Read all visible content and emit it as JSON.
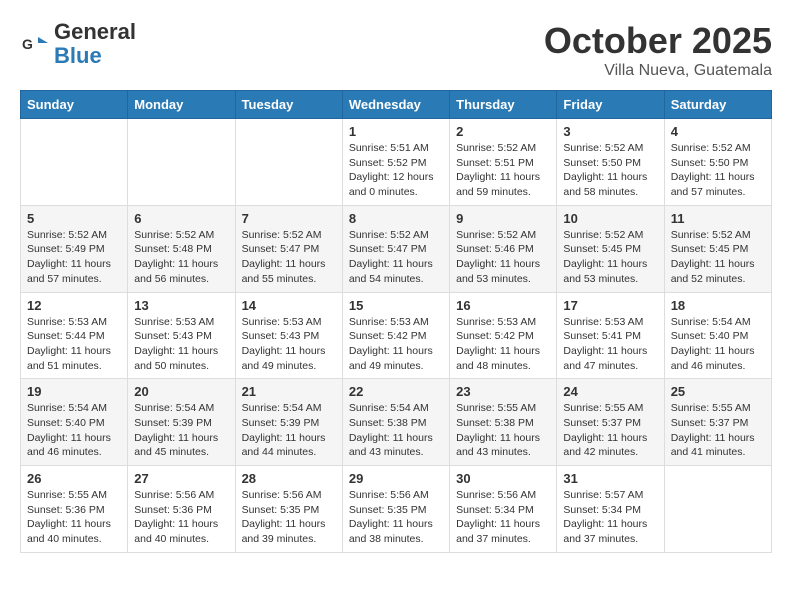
{
  "header": {
    "logo_line1": "General",
    "logo_line2": "Blue",
    "month_title": "October 2025",
    "location": "Villa Nueva, Guatemala"
  },
  "weekdays": [
    "Sunday",
    "Monday",
    "Tuesday",
    "Wednesday",
    "Thursday",
    "Friday",
    "Saturday"
  ],
  "weeks": [
    [
      {
        "day": "",
        "info": ""
      },
      {
        "day": "",
        "info": ""
      },
      {
        "day": "",
        "info": ""
      },
      {
        "day": "1",
        "info": "Sunrise: 5:51 AM\nSunset: 5:52 PM\nDaylight: 12 hours\nand 0 minutes."
      },
      {
        "day": "2",
        "info": "Sunrise: 5:52 AM\nSunset: 5:51 PM\nDaylight: 11 hours\nand 59 minutes."
      },
      {
        "day": "3",
        "info": "Sunrise: 5:52 AM\nSunset: 5:50 PM\nDaylight: 11 hours\nand 58 minutes."
      },
      {
        "day": "4",
        "info": "Sunrise: 5:52 AM\nSunset: 5:50 PM\nDaylight: 11 hours\nand 57 minutes."
      }
    ],
    [
      {
        "day": "5",
        "info": "Sunrise: 5:52 AM\nSunset: 5:49 PM\nDaylight: 11 hours\nand 57 minutes."
      },
      {
        "day": "6",
        "info": "Sunrise: 5:52 AM\nSunset: 5:48 PM\nDaylight: 11 hours\nand 56 minutes."
      },
      {
        "day": "7",
        "info": "Sunrise: 5:52 AM\nSunset: 5:47 PM\nDaylight: 11 hours\nand 55 minutes."
      },
      {
        "day": "8",
        "info": "Sunrise: 5:52 AM\nSunset: 5:47 PM\nDaylight: 11 hours\nand 54 minutes."
      },
      {
        "day": "9",
        "info": "Sunrise: 5:52 AM\nSunset: 5:46 PM\nDaylight: 11 hours\nand 53 minutes."
      },
      {
        "day": "10",
        "info": "Sunrise: 5:52 AM\nSunset: 5:45 PM\nDaylight: 11 hours\nand 53 minutes."
      },
      {
        "day": "11",
        "info": "Sunrise: 5:52 AM\nSunset: 5:45 PM\nDaylight: 11 hours\nand 52 minutes."
      }
    ],
    [
      {
        "day": "12",
        "info": "Sunrise: 5:53 AM\nSunset: 5:44 PM\nDaylight: 11 hours\nand 51 minutes."
      },
      {
        "day": "13",
        "info": "Sunrise: 5:53 AM\nSunset: 5:43 PM\nDaylight: 11 hours\nand 50 minutes."
      },
      {
        "day": "14",
        "info": "Sunrise: 5:53 AM\nSunset: 5:43 PM\nDaylight: 11 hours\nand 49 minutes."
      },
      {
        "day": "15",
        "info": "Sunrise: 5:53 AM\nSunset: 5:42 PM\nDaylight: 11 hours\nand 49 minutes."
      },
      {
        "day": "16",
        "info": "Sunrise: 5:53 AM\nSunset: 5:42 PM\nDaylight: 11 hours\nand 48 minutes."
      },
      {
        "day": "17",
        "info": "Sunrise: 5:53 AM\nSunset: 5:41 PM\nDaylight: 11 hours\nand 47 minutes."
      },
      {
        "day": "18",
        "info": "Sunrise: 5:54 AM\nSunset: 5:40 PM\nDaylight: 11 hours\nand 46 minutes."
      }
    ],
    [
      {
        "day": "19",
        "info": "Sunrise: 5:54 AM\nSunset: 5:40 PM\nDaylight: 11 hours\nand 46 minutes."
      },
      {
        "day": "20",
        "info": "Sunrise: 5:54 AM\nSunset: 5:39 PM\nDaylight: 11 hours\nand 45 minutes."
      },
      {
        "day": "21",
        "info": "Sunrise: 5:54 AM\nSunset: 5:39 PM\nDaylight: 11 hours\nand 44 minutes."
      },
      {
        "day": "22",
        "info": "Sunrise: 5:54 AM\nSunset: 5:38 PM\nDaylight: 11 hours\nand 43 minutes."
      },
      {
        "day": "23",
        "info": "Sunrise: 5:55 AM\nSunset: 5:38 PM\nDaylight: 11 hours\nand 43 minutes."
      },
      {
        "day": "24",
        "info": "Sunrise: 5:55 AM\nSunset: 5:37 PM\nDaylight: 11 hours\nand 42 minutes."
      },
      {
        "day": "25",
        "info": "Sunrise: 5:55 AM\nSunset: 5:37 PM\nDaylight: 11 hours\nand 41 minutes."
      }
    ],
    [
      {
        "day": "26",
        "info": "Sunrise: 5:55 AM\nSunset: 5:36 PM\nDaylight: 11 hours\nand 40 minutes."
      },
      {
        "day": "27",
        "info": "Sunrise: 5:56 AM\nSunset: 5:36 PM\nDaylight: 11 hours\nand 40 minutes."
      },
      {
        "day": "28",
        "info": "Sunrise: 5:56 AM\nSunset: 5:35 PM\nDaylight: 11 hours\nand 39 minutes."
      },
      {
        "day": "29",
        "info": "Sunrise: 5:56 AM\nSunset: 5:35 PM\nDaylight: 11 hours\nand 38 minutes."
      },
      {
        "day": "30",
        "info": "Sunrise: 5:56 AM\nSunset: 5:34 PM\nDaylight: 11 hours\nand 37 minutes."
      },
      {
        "day": "31",
        "info": "Sunrise: 5:57 AM\nSunset: 5:34 PM\nDaylight: 11 hours\nand 37 minutes."
      },
      {
        "day": "",
        "info": ""
      }
    ]
  ]
}
